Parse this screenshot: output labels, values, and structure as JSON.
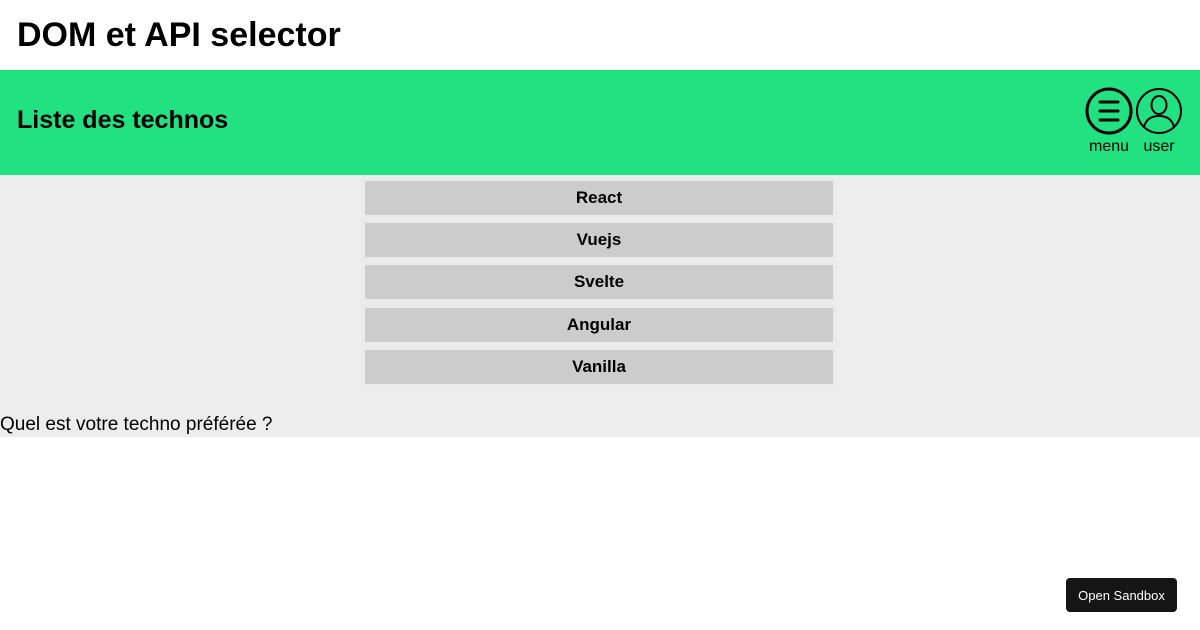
{
  "page": {
    "title": "DOM et API selector"
  },
  "header": {
    "title": "Liste des technos",
    "menu_label": "menu",
    "user_label": "user",
    "menu_icon": "hamburger-menu-icon",
    "user_icon": "user-icon",
    "background_color": "#22e181"
  },
  "techs": [
    "React",
    "Vuejs",
    "Svelte",
    "Angular",
    "Vanilla"
  ],
  "question": "Quel est votre techno préférée ?",
  "sandbox": {
    "label": "Open Sandbox"
  }
}
